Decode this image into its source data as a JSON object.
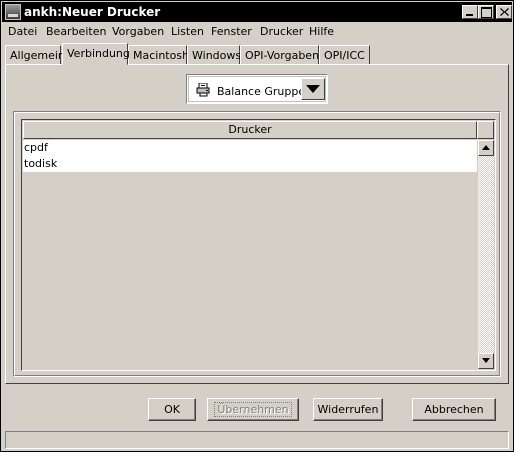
{
  "window": {
    "title": "ankh:Neuer Drucker"
  },
  "menu": [
    "Datei",
    "Bearbeiten",
    "Vorgaben",
    "Listen",
    "Fenster",
    "Drucker",
    "Hilfe"
  ],
  "tabs": [
    "Allgemein",
    "Verbindung",
    "Macintosh",
    "Windows",
    "OPI-Vorgaben",
    "OPI/ICC"
  ],
  "active_tab": "Verbindung",
  "group_select": {
    "selected": "Balance Gruppe",
    "icon": "printer-group-icon"
  },
  "table": {
    "column_header": "Drucker",
    "rows": [
      "cpdf",
      "todisk"
    ]
  },
  "buttons": {
    "ok": "OK",
    "apply": "Übernehmen",
    "revert": "Widerrufen",
    "cancel": "Abbrechen"
  },
  "colors": {
    "titlebar_bg": "#000000",
    "face": "#d4d0c8"
  }
}
